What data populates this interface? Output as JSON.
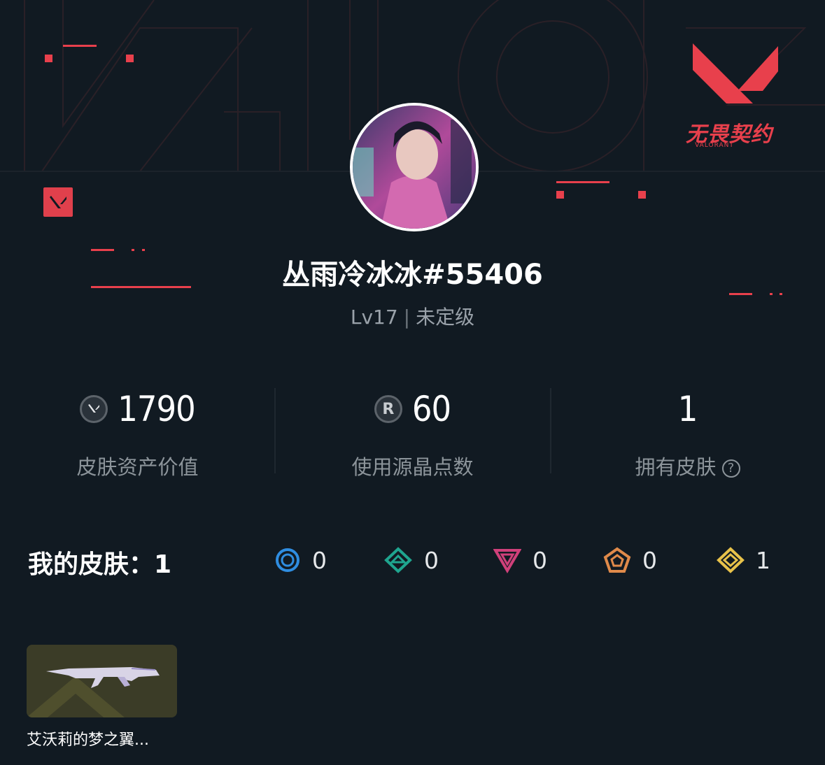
{
  "brand": {
    "name": "无畏契约",
    "sub": "VALORANT",
    "color": "#e8404c",
    "logo_icon": "valorant-v-logo"
  },
  "profile": {
    "username": "丛雨冷冰冰#55406",
    "level": "Lv17",
    "rank": "未定级",
    "avatar": "agent-portrait-avatar"
  },
  "stats": [
    {
      "icon": "valorant-points-icon",
      "value": "1790",
      "label": "皮肤资产价值"
    },
    {
      "icon": "radianite-points-icon",
      "icon_letter": "R",
      "value": "60",
      "label": "使用源晶点数"
    },
    {
      "icon": "",
      "value": "1",
      "label": "拥有皮肤",
      "help": "?"
    }
  ],
  "skins": {
    "title": "我的皮肤：1",
    "tiers": [
      {
        "icon": "select-tier-icon",
        "color": "#2f8de0",
        "count": "0"
      },
      {
        "icon": "deluxe-tier-icon",
        "color": "#1fa58f",
        "count": "0"
      },
      {
        "icon": "premium-tier-icon",
        "color": "#d0407a",
        "count": "0"
      },
      {
        "icon": "exclusive-tier-icon",
        "color": "#e08a4a",
        "count": "0"
      },
      {
        "icon": "ultra-tier-icon",
        "color": "#e8c24a",
        "count": "1"
      }
    ],
    "items": [
      {
        "name": "艾沃莉的梦之翼...",
        "image": "rifle-skin-image"
      }
    ]
  }
}
